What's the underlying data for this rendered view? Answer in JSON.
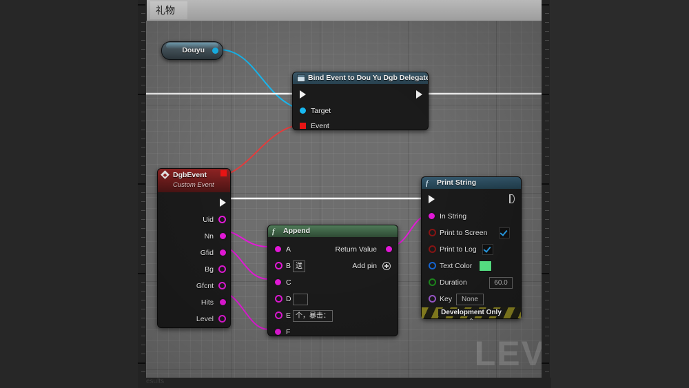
{
  "editor": {
    "tab_label": "礼物",
    "status_text": "esults",
    "watermark": "LEV"
  },
  "graph": {
    "douyu_node": {
      "label": "Douyu",
      "out_pin": "exec-blue-pin"
    },
    "bind_node": {
      "title": "Bind Event to Dou Yu Dgb Delegate",
      "icon": "bind-delegate-icon",
      "inputs": [
        {
          "label": "",
          "kind": "exec"
        },
        {
          "label": "Target",
          "kind": "object"
        },
        {
          "label": "Event",
          "kind": "delegate"
        }
      ],
      "outputs": [
        {
          "label": "",
          "kind": "exec"
        }
      ]
    },
    "event_node": {
      "title": "DgbEvent",
      "subtitle": "Custom Event",
      "icon": "event-diamond-icon",
      "outputs": [
        {
          "label": "Uid",
          "connected": false
        },
        {
          "label": "Nn",
          "connected": true
        },
        {
          "label": "Gfid",
          "connected": true
        },
        {
          "label": "Bg",
          "connected": false
        },
        {
          "label": "Gfcnt",
          "connected": false
        },
        {
          "label": "Hits",
          "connected": true
        },
        {
          "label": "Level",
          "connected": false
        }
      ]
    },
    "append_node": {
      "title": "Append",
      "icon": "function-icon",
      "inputs": [
        {
          "label": "A",
          "connected": true,
          "value": null
        },
        {
          "label": "B",
          "connected": false,
          "value": "送"
        },
        {
          "label": "C",
          "connected": true,
          "value": null
        },
        {
          "label": "D",
          "connected": false,
          "value": ""
        },
        {
          "label": "E",
          "connected": false,
          "value": "个，暴击："
        },
        {
          "label": "F",
          "connected": true,
          "value": null
        }
      ],
      "outputs": [
        {
          "label": "Return Value",
          "connected": true
        }
      ],
      "add_pin_label": "Add pin"
    },
    "print_node": {
      "title": "Print String",
      "icon": "function-icon",
      "inputs": [
        {
          "label": "In String",
          "widget": "none"
        },
        {
          "label": "Print to Screen",
          "widget": "checkbox",
          "value": "checked"
        },
        {
          "label": "Print to Log",
          "widget": "checkbox",
          "value": "checked"
        },
        {
          "label": "Text Color",
          "widget": "color",
          "value": "#5cf08c"
        },
        {
          "label": "Duration",
          "widget": "text",
          "value": "60.0"
        },
        {
          "label": "Key",
          "widget": "text",
          "value": "None"
        }
      ],
      "footer_label": "Development Only",
      "collapse_glyph": "⌃"
    }
  },
  "colors": {
    "exec_wire": "#f5f5f5",
    "string_wire": "#e318d8",
    "object_wire": "#18b8f0",
    "delegate_wire": "#e33c3c",
    "canvas": "#6e6e6e"
  }
}
